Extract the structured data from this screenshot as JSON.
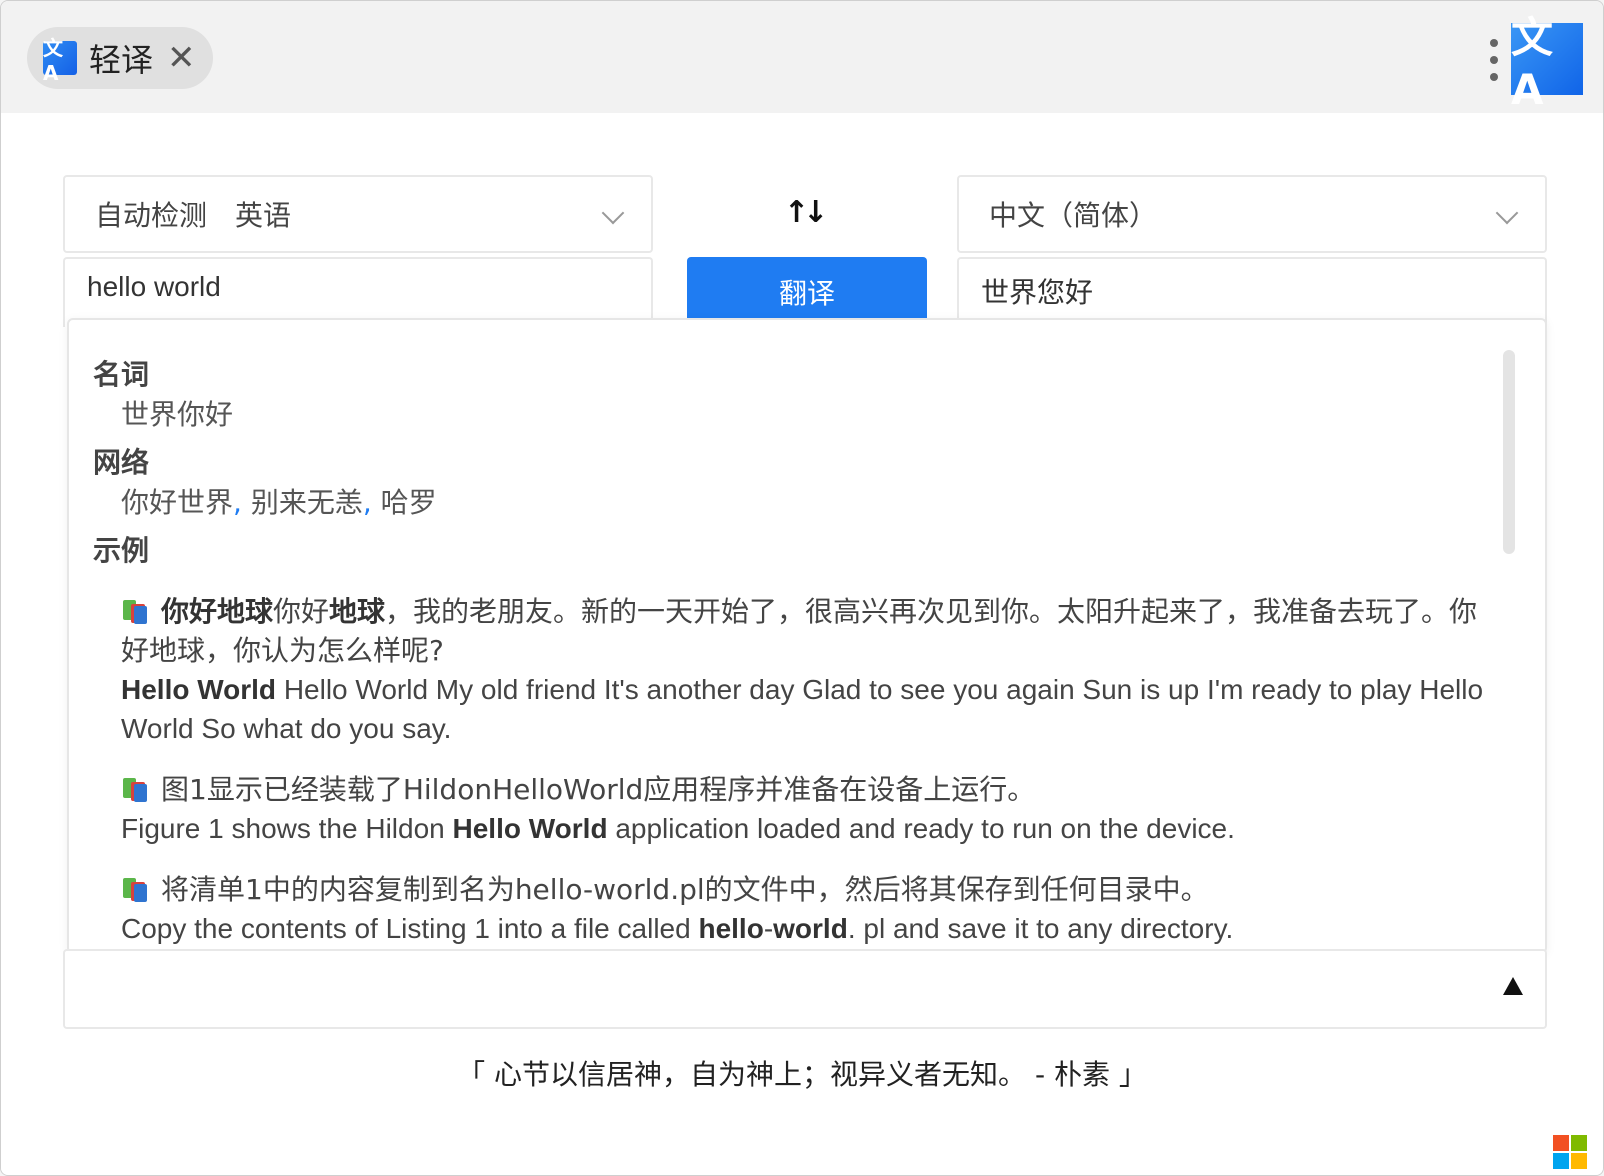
{
  "app": {
    "tab_title": "轻译",
    "tab_icon": "文A",
    "logo_text": "文A",
    "accent_color": "#1f7cf2"
  },
  "toolbar": {
    "source_language": "自动检测",
    "detected_language": "英语",
    "target_language": "中文（简体）",
    "swap_symbol": "↑↓",
    "translate_label": "翻译"
  },
  "source": {
    "text": "hello world"
  },
  "result": {
    "text": "世界您好"
  },
  "dictionary": {
    "sections": [
      {
        "pos": "名词",
        "meanings": [
          "世界你好"
        ]
      },
      {
        "pos": "网络",
        "meanings": [
          "你好世界",
          "别来无恙",
          "哈罗"
        ]
      }
    ],
    "examples_heading": "示例",
    "examples": [
      {
        "cn_parts": [
          {
            "text": "你好地球",
            "bold": true
          },
          {
            "text": "你好",
            "bold": false
          },
          {
            "text": "地球",
            "bold": true
          },
          {
            "text": "，我的老朋友。新的一天开始了，很高兴再次见到你。太阳升起来了，我准备去玩了。你好地球，你认为怎么样呢?",
            "bold": false
          }
        ],
        "en_parts": [
          {
            "text": "Hello World",
            "bold": true
          },
          {
            "text": " Hello World My old friend It's another day Glad to see you again Sun is up I'm ready to play Hello World So what do you say.",
            "bold": false
          }
        ]
      },
      {
        "cn_parts": [
          {
            "text": "图1显示已经装载了HildonHelloWorld应用程序并准备在设备上运行。",
            "bold": false
          }
        ],
        "en_parts": [
          {
            "text": "Figure 1 shows the Hildon ",
            "bold": false
          },
          {
            "text": "Hello World",
            "bold": true
          },
          {
            "text": " application loaded and ready to run on the device.",
            "bold": false
          }
        ]
      },
      {
        "cn_parts": [
          {
            "text": "将清单1中的内容复制到名为hello-world.pl的文件中，然后将其保存到任何目录中。",
            "bold": false
          }
        ],
        "en_parts": [
          {
            "text": "Copy the contents of Listing 1 into a file called ",
            "bold": false
          },
          {
            "text": "hello",
            "bold": true
          },
          {
            "text": "-",
            "bold": false
          },
          {
            "text": "world",
            "bold": true
          },
          {
            "text": ". pl and save it to any directory.",
            "bold": false
          }
        ]
      }
    ]
  },
  "footer": {
    "quote": "「 心节以信居神，自为神上；视异义者无知。 - 朴素 」"
  },
  "icons": {
    "close": "close-icon",
    "more": "more-vertical-icon",
    "chevron": "chevron-down-icon",
    "swap": "swap-icon",
    "book": "book-icon",
    "collapse": "triangle-up-icon",
    "windows": "windows-logo-icon"
  },
  "colors": {
    "windows_logo": [
      "#f25022",
      "#7fba00",
      "#00a4ef",
      "#ffb900"
    ]
  }
}
